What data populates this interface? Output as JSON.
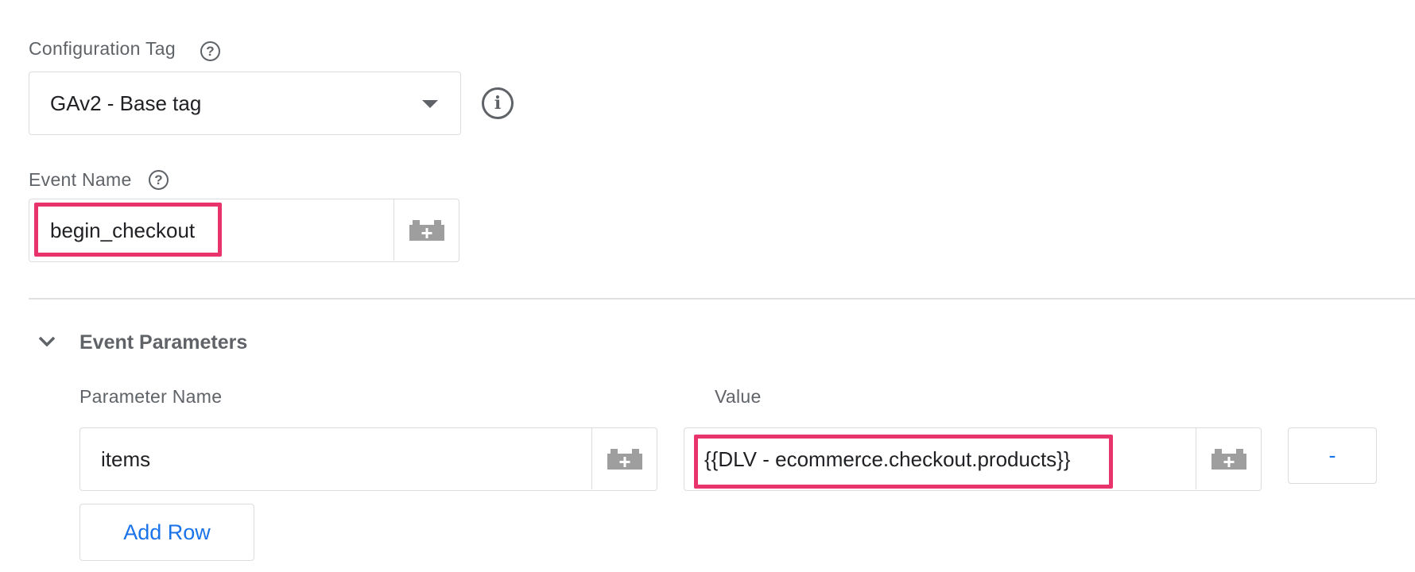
{
  "config_tag": {
    "label": "Configuration Tag",
    "help_icon": "help-circle",
    "selected_value": "GAv2 - Base tag",
    "dropdown_icon": "caret-down",
    "info_icon": "info-circle"
  },
  "event_name": {
    "label": "Event Name",
    "help_icon": "help-circle",
    "value": "begin_checkout",
    "variable_icon": "variable-brick-plus"
  },
  "event_parameters": {
    "title": "Event Parameters",
    "collapse_icon": "chevron-down",
    "columns": {
      "name": "Parameter Name",
      "value": "Value"
    },
    "rows": [
      {
        "name": "items",
        "value": "{{DLV - ecommerce.checkout.products}}",
        "remove_label": "-"
      }
    ],
    "add_row_label": "Add Row"
  },
  "colors": {
    "highlight": "#e8336b",
    "link_blue": "#1a73e8",
    "label_gray": "#5f6368",
    "border": "#dadce0"
  }
}
